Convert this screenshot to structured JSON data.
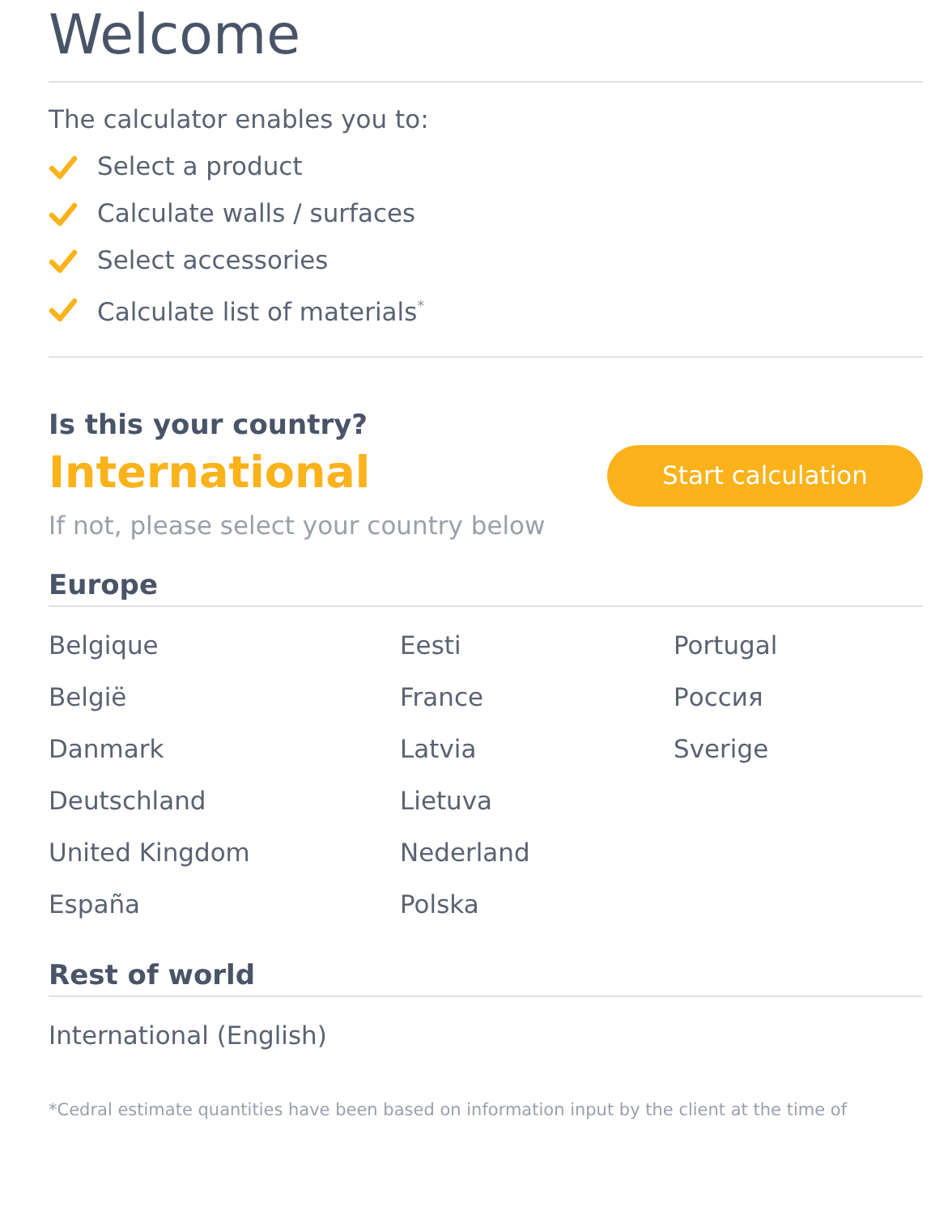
{
  "heading": "Welcome",
  "intro": "The calculator enables you to:",
  "features": [
    "Select a product",
    "Calculate walls / surfaces",
    "Select accessories",
    "Calculate list of materials$^{*}$"
  ],
  "country_prompt": {
    "question": "Is this your country?",
    "country": "International",
    "hint": "If not, please select your country below",
    "button": "Start calculation"
  },
  "regions": [
    {
      "title": "Europe",
      "columns": [
        [
          "Belgique",
          "België",
          "Danmark",
          "Deutschland",
          "United Kingdom",
          "España"
        ],
        [
          "Eesti",
          "France",
          "Latvia",
          "Lietuva",
          "Nederland",
          "Polska"
        ],
        [
          "Portugal",
          "Россия",
          "Sverige"
        ]
      ]
    },
    {
      "title": "Rest of world",
      "columns": [
        [
          "International (English)"
        ]
      ]
    }
  ],
  "footnote": "*Cedral estimate quantities have been based on information input by the client at the time of"
}
